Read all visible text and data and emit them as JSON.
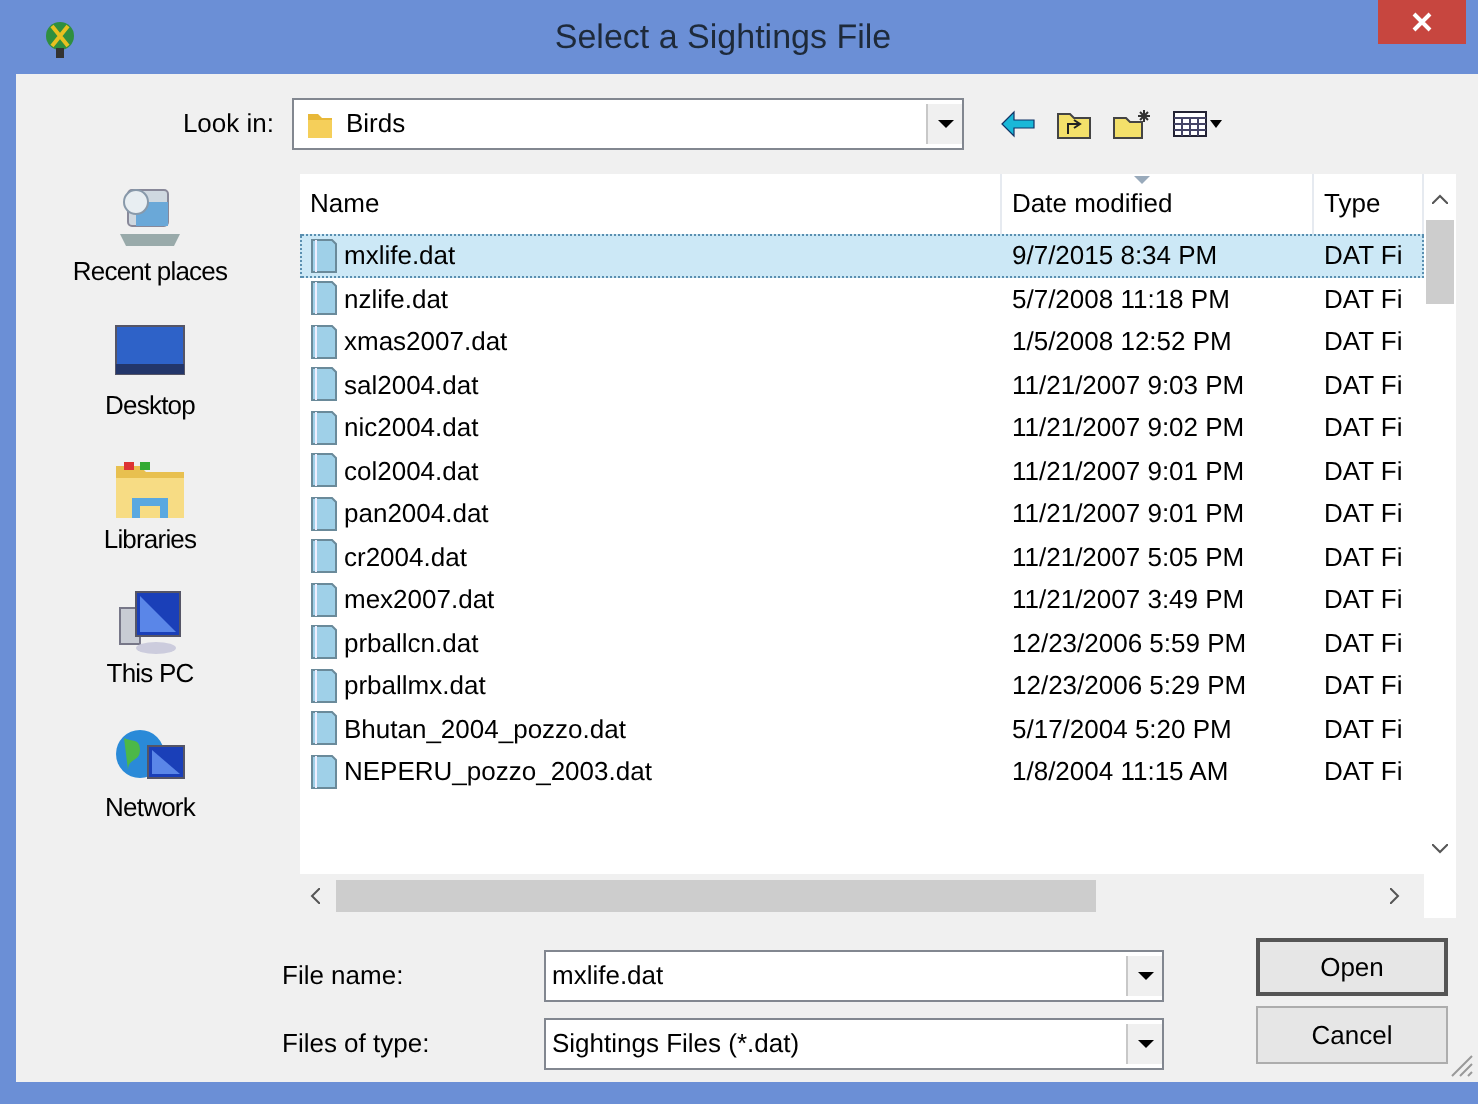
{
  "window": {
    "title": "Select a Sightings File"
  },
  "look_in": {
    "label": "Look in:",
    "value": "Birds"
  },
  "places": [
    {
      "label": "Recent places",
      "kind": "recent"
    },
    {
      "label": "Desktop",
      "kind": "desktop"
    },
    {
      "label": "Libraries",
      "kind": "libraries"
    },
    {
      "label": "This PC",
      "kind": "pc"
    },
    {
      "label": "Network",
      "kind": "network"
    }
  ],
  "table": {
    "columns": [
      "Name",
      "Date modified",
      "Type"
    ],
    "rows": [
      {
        "name": "mxlife.dat",
        "date": "9/7/2015 8:34 PM",
        "type": "DAT Fi",
        "selected": true
      },
      {
        "name": "nzlife.dat",
        "date": "5/7/2008 11:18 PM",
        "type": "DAT Fi",
        "selected": false
      },
      {
        "name": "xmas2007.dat",
        "date": "1/5/2008 12:52 PM",
        "type": "DAT Fi",
        "selected": false
      },
      {
        "name": "sal2004.dat",
        "date": "11/21/2007 9:03 PM",
        "type": "DAT Fi",
        "selected": false
      },
      {
        "name": "nic2004.dat",
        "date": "11/21/2007 9:02 PM",
        "type": "DAT Fi",
        "selected": false
      },
      {
        "name": "col2004.dat",
        "date": "11/21/2007 9:01 PM",
        "type": "DAT Fi",
        "selected": false
      },
      {
        "name": "pan2004.dat",
        "date": "11/21/2007 9:01 PM",
        "type": "DAT Fi",
        "selected": false
      },
      {
        "name": "cr2004.dat",
        "date": "11/21/2007 5:05 PM",
        "type": "DAT Fi",
        "selected": false
      },
      {
        "name": "mex2007.dat",
        "date": "11/21/2007 3:49 PM",
        "type": "DAT Fi",
        "selected": false
      },
      {
        "name": "prballcn.dat",
        "date": "12/23/2006 5:59 PM",
        "type": "DAT Fi",
        "selected": false
      },
      {
        "name": "prballmx.dat",
        "date": "12/23/2006 5:29 PM",
        "type": "DAT Fi",
        "selected": false
      },
      {
        "name": "Bhutan_2004_pozzo.dat",
        "date": "5/17/2004 5:20 PM",
        "type": "DAT Fi",
        "selected": false
      },
      {
        "name": "NEPERU_pozzo_2003.dat",
        "date": "1/8/2004 11:15 AM",
        "type": "DAT Fi",
        "selected": false
      }
    ]
  },
  "file_name": {
    "label": "File name:",
    "value": "mxlife.dat"
  },
  "file_type": {
    "label": "Files of type:",
    "value": "Sightings Files (*.dat)"
  },
  "buttons": [
    "Open",
    "Cancel"
  ]
}
